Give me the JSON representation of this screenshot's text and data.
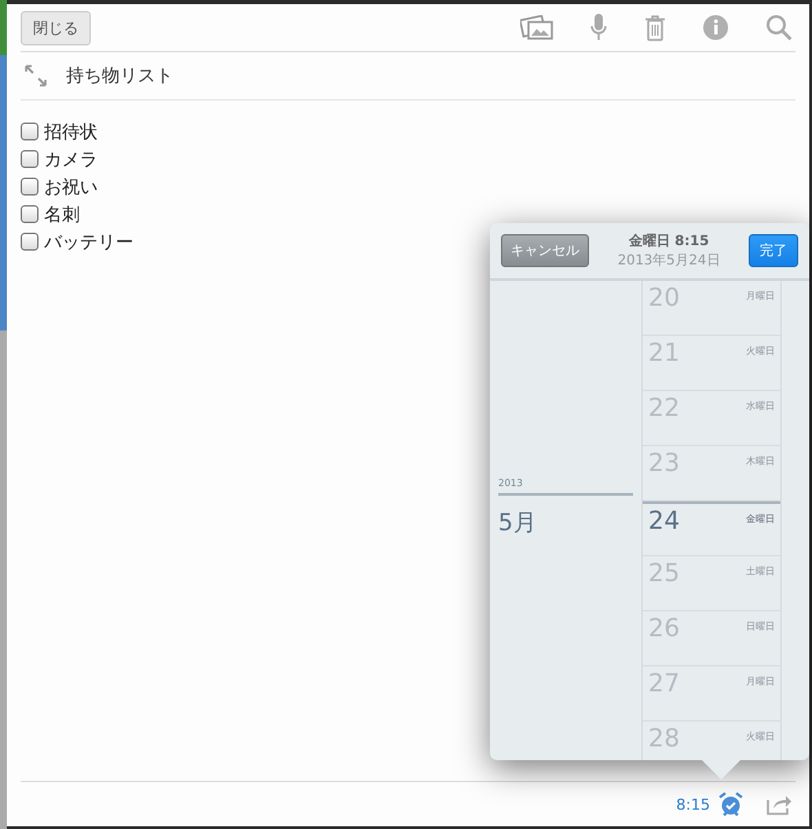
{
  "toolbar": {
    "close_button": "閉じる"
  },
  "note": {
    "title": "持ち物リスト",
    "items": [
      {
        "label": "招待状",
        "checked": false
      },
      {
        "label": "カメラ",
        "checked": false
      },
      {
        "label": "お祝い",
        "checked": false
      },
      {
        "label": "名刺",
        "checked": false
      },
      {
        "label": "バッテリー",
        "checked": false
      }
    ]
  },
  "date_picker": {
    "cancel": "キャンセル",
    "heading": "金曜日 8:15",
    "subheading": "2013年5月24日",
    "done": "完了",
    "month": {
      "year": "2013",
      "label": "5月"
    },
    "days": [
      {
        "day": "20",
        "weekday": "月曜日",
        "selected": false
      },
      {
        "day": "21",
        "weekday": "火曜日",
        "selected": false
      },
      {
        "day": "22",
        "weekday": "水曜日",
        "selected": false
      },
      {
        "day": "23",
        "weekday": "木曜日",
        "selected": false
      },
      {
        "day": "24",
        "weekday": "金曜日",
        "selected": true
      },
      {
        "day": "25",
        "weekday": "土曜日",
        "selected": false
      },
      {
        "day": "26",
        "weekday": "日曜日",
        "selected": false
      },
      {
        "day": "27",
        "weekday": "月曜日",
        "selected": false
      },
      {
        "day": "28",
        "weekday": "火曜日",
        "selected": false
      }
    ]
  },
  "footer": {
    "reminder_time": "8:15"
  }
}
